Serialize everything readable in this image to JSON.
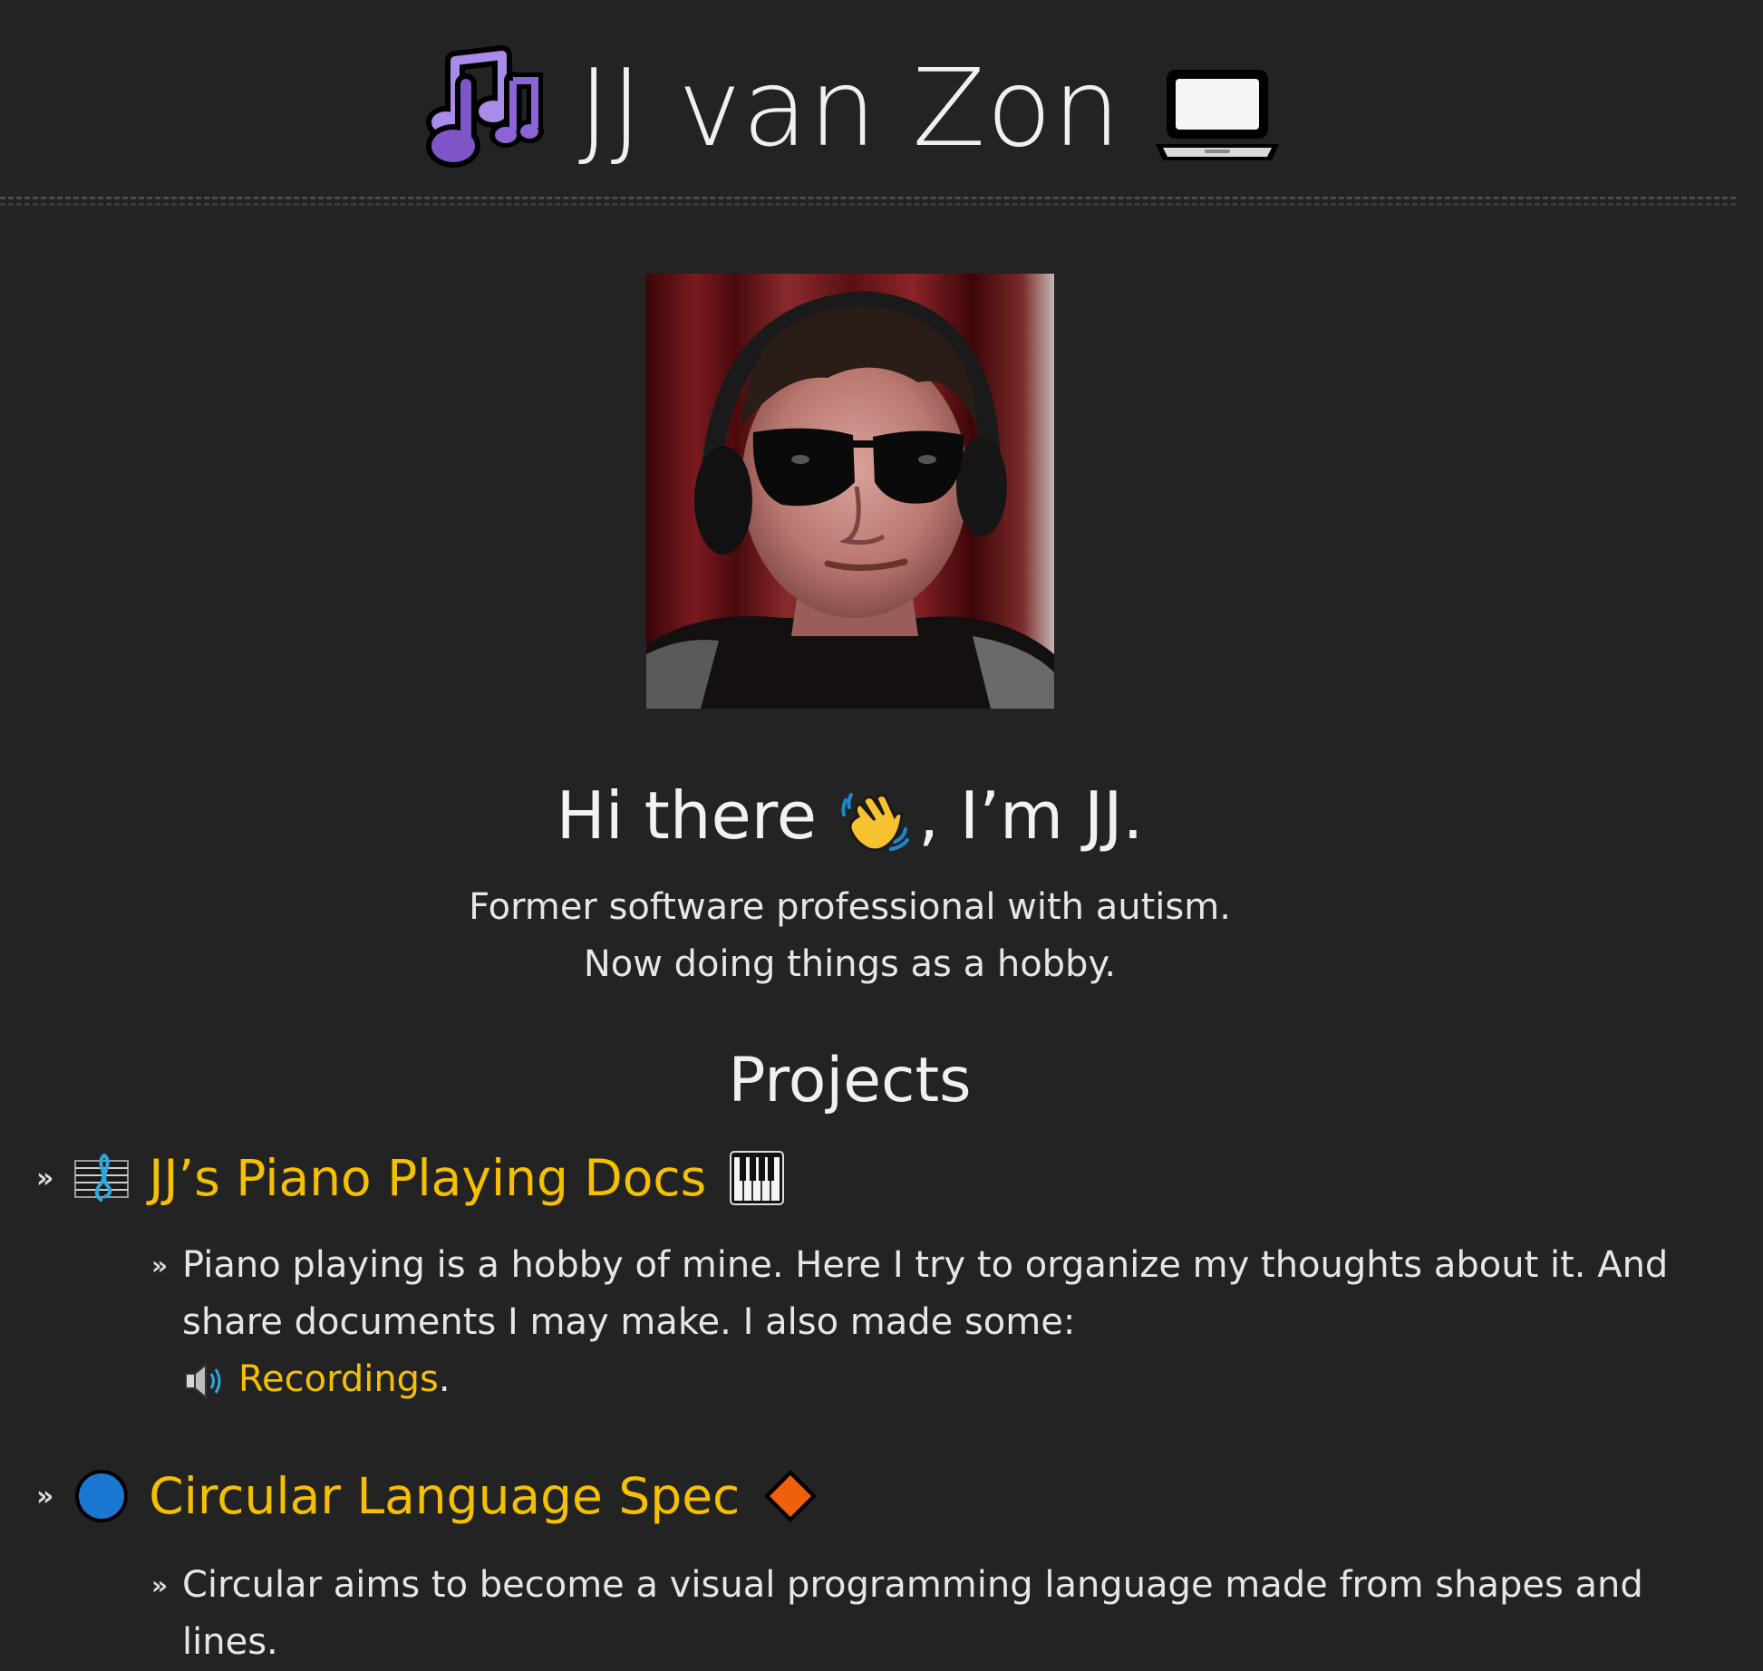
{
  "header": {
    "title": "JJ van Zon",
    "left_icon": "musical-notes-icon",
    "right_icon": "laptop-icon"
  },
  "avatar": {
    "alt": "JJ wearing sunglasses and headphones"
  },
  "intro": {
    "greeting_start": "Hi there",
    "greeting_end": ", I’m JJ.",
    "bio_line1": "Former software professional with autism.",
    "bio_line2": "Now doing things as a hobby."
  },
  "projects": {
    "heading": "Projects",
    "items": [
      {
        "bullet": "»",
        "icon": "musical-score-icon",
        "title": "JJ’s Piano Playing Docs",
        "end_icon": "piano-keys-icon",
        "description": "Piano playing is a hobby of mine. Here I try to organize my thoughts about it. And share documents I may make. I also made some:",
        "recordings_label": "Recordings",
        "recordings_suffix": "."
      },
      {
        "bullet": "»",
        "icon": "blue-circle-icon",
        "title": "Circular Language Spec",
        "end_icon": "orange-diamond-icon",
        "description": "Circular aims to become a visual programming language made from shapes and lines."
      }
    ]
  },
  "colors": {
    "background": "#232323",
    "text": "#e6e6e6",
    "link": "#f5c000",
    "accent_purple": "#7d55c7",
    "accent_blue": "#1a78d2",
    "accent_orange": "#f0600a"
  }
}
